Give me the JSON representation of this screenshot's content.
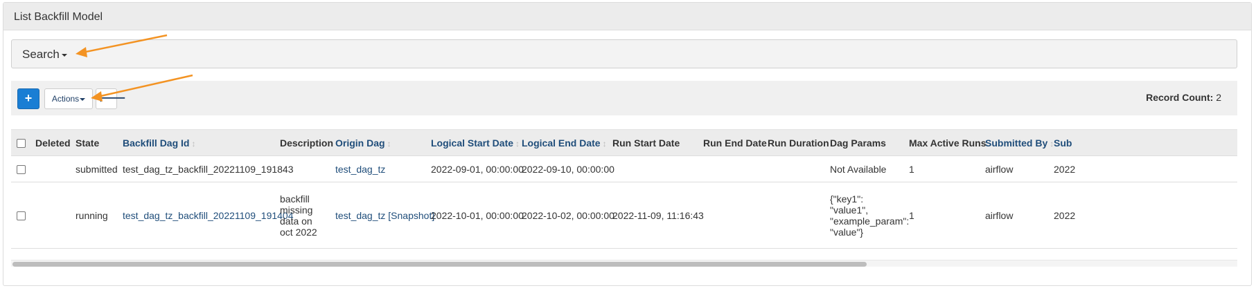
{
  "panel": {
    "title": "List Backfill Model"
  },
  "search": {
    "label": "Search"
  },
  "toolbar": {
    "add_label": "+",
    "actions_label": "Actions",
    "back_label": "🡐",
    "record_count_label": "Record Count:",
    "record_count_value": "2"
  },
  "table": {
    "columns": {
      "deleted": "Deleted",
      "state": "State",
      "backfill_dag_id": "Backfill Dag Id",
      "description": "Description",
      "origin_dag": "Origin Dag",
      "logical_start_date": "Logical Start Date",
      "logical_end_date": "Logical End Date",
      "run_start_date": "Run Start Date",
      "run_end_date": "Run End Date",
      "run_duration": "Run Duration",
      "dag_params": "Dag Params",
      "max_active_runs": "Max Active Runs",
      "submitted_by": "Submitted By",
      "submitted_at": "Sub"
    },
    "rows": [
      {
        "deleted": "",
        "state": "submitted",
        "backfill_dag_id": "test_dag_tz_backfill_20221109_191843",
        "description": "",
        "origin_dag": "test_dag_tz",
        "origin_dag_extra": "",
        "logical_start_date": "2022-09-01, 00:00:00",
        "logical_end_date": "2022-09-10, 00:00:00",
        "run_start_date": "",
        "run_end_date": "",
        "run_duration": "",
        "dag_params": "Not Available",
        "max_active_runs": "1",
        "submitted_by": "airflow",
        "submitted_at": "2022"
      },
      {
        "deleted": "",
        "state": "running",
        "backfill_dag_id": "test_dag_tz_backfill_20221109_191404",
        "description": "backfill missing data on oct 2022",
        "origin_dag": "test_dag_tz",
        "origin_dag_extra": "[Snapshot]",
        "logical_start_date": "2022-10-01, 00:00:00",
        "logical_end_date": "2022-10-02, 00:00:00",
        "run_start_date": "2022-11-09, 11:16:43",
        "run_end_date": "",
        "run_duration": "",
        "dag_params": "{\"key1\": \"value1\", \"example_param\": \"value\"}",
        "max_active_runs": "1",
        "submitted_by": "airflow",
        "submitted_at": "2022"
      }
    ]
  },
  "colors": {
    "accent": "#1a7ed4",
    "link": "#1f4d7a",
    "annotation_arrow": "#f39323"
  },
  "icons": [
    "caret-down-icon",
    "plus-icon",
    "arrow-left-icon",
    "sort-icon",
    "checkbox-icon"
  ]
}
